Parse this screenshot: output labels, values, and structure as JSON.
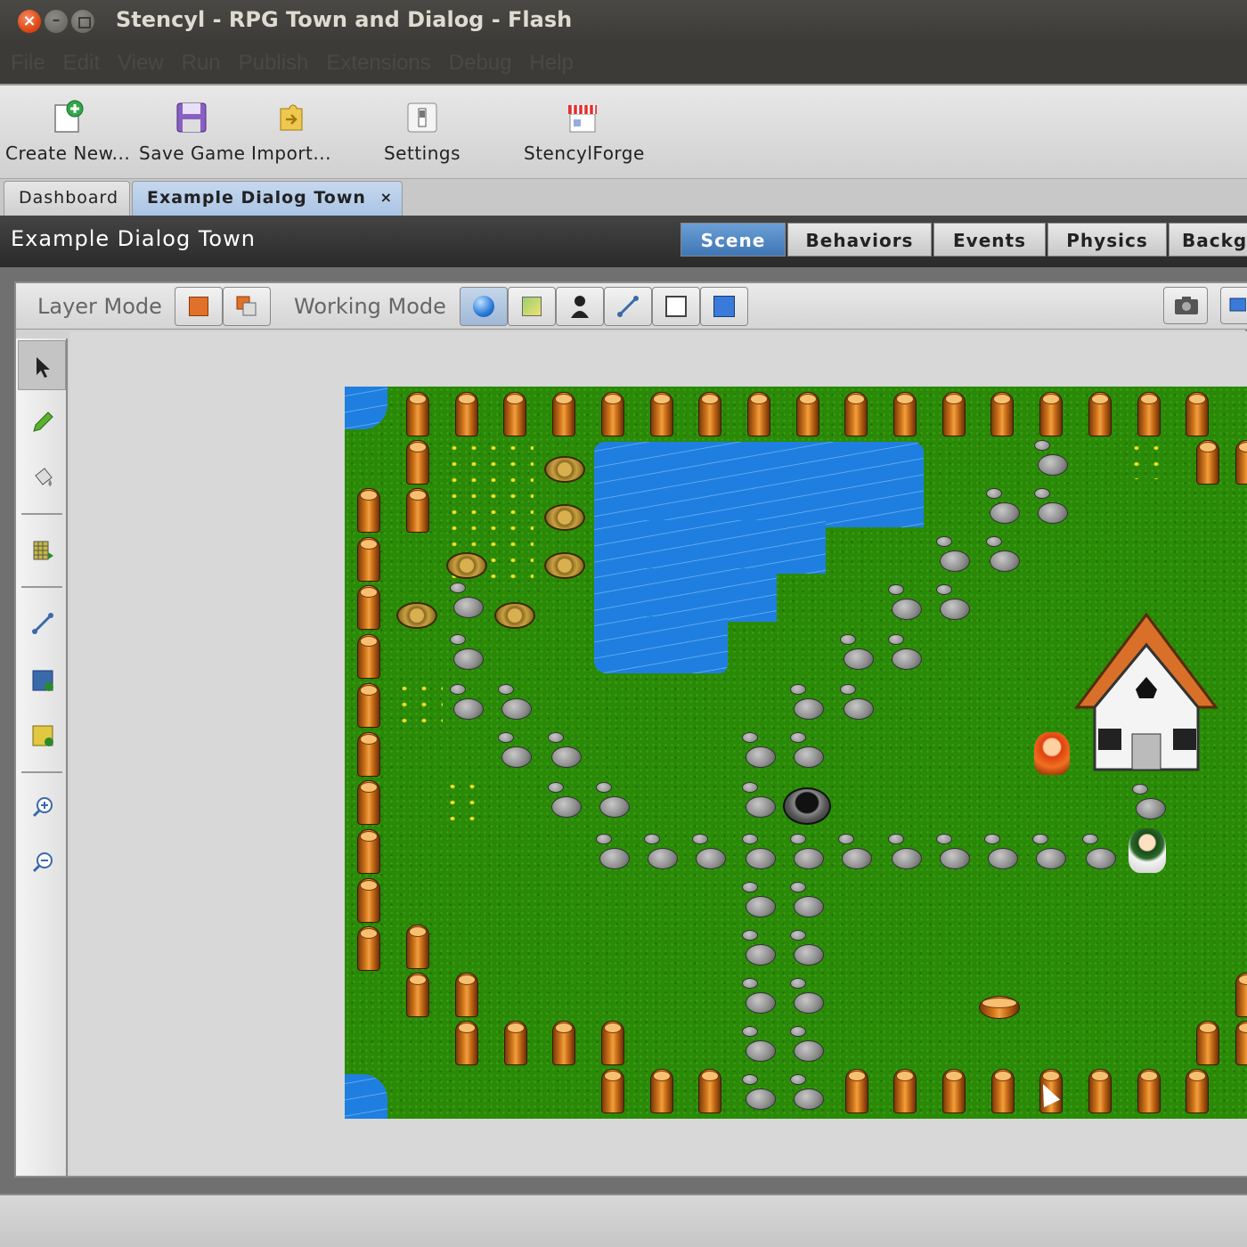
{
  "window": {
    "title": "Stencyl - RPG Town and Dialog - Flash"
  },
  "menu": [
    "File",
    "Edit",
    "View",
    "Run",
    "Publish",
    "Extensions",
    "Debug",
    "Help"
  ],
  "toolbar": {
    "create_new": "Create New...",
    "save_game": "Save Game",
    "import": "Import...",
    "settings": "Settings",
    "stencylforge": "StencylForge"
  },
  "doc_tabs": {
    "dashboard": "Dashboard",
    "active": "Example Dialog Town",
    "close": "×"
  },
  "header": {
    "title": "Example Dialog Town"
  },
  "view_tabs": [
    "Scene",
    "Behaviors",
    "Events",
    "Physics",
    "Backg"
  ],
  "modebar": {
    "layer_mode": "Layer Mode",
    "working_mode": "Working Mode"
  },
  "colors": {
    "accent": "#3f76b4",
    "grass": "#2a8a08",
    "water": "#1f7fe0"
  },
  "icons": {
    "create": "new-document-icon",
    "save": "floppy-icon",
    "import": "import-puzzle-icon",
    "settings": "settings-switch-icon",
    "forge": "store-awning-icon"
  }
}
